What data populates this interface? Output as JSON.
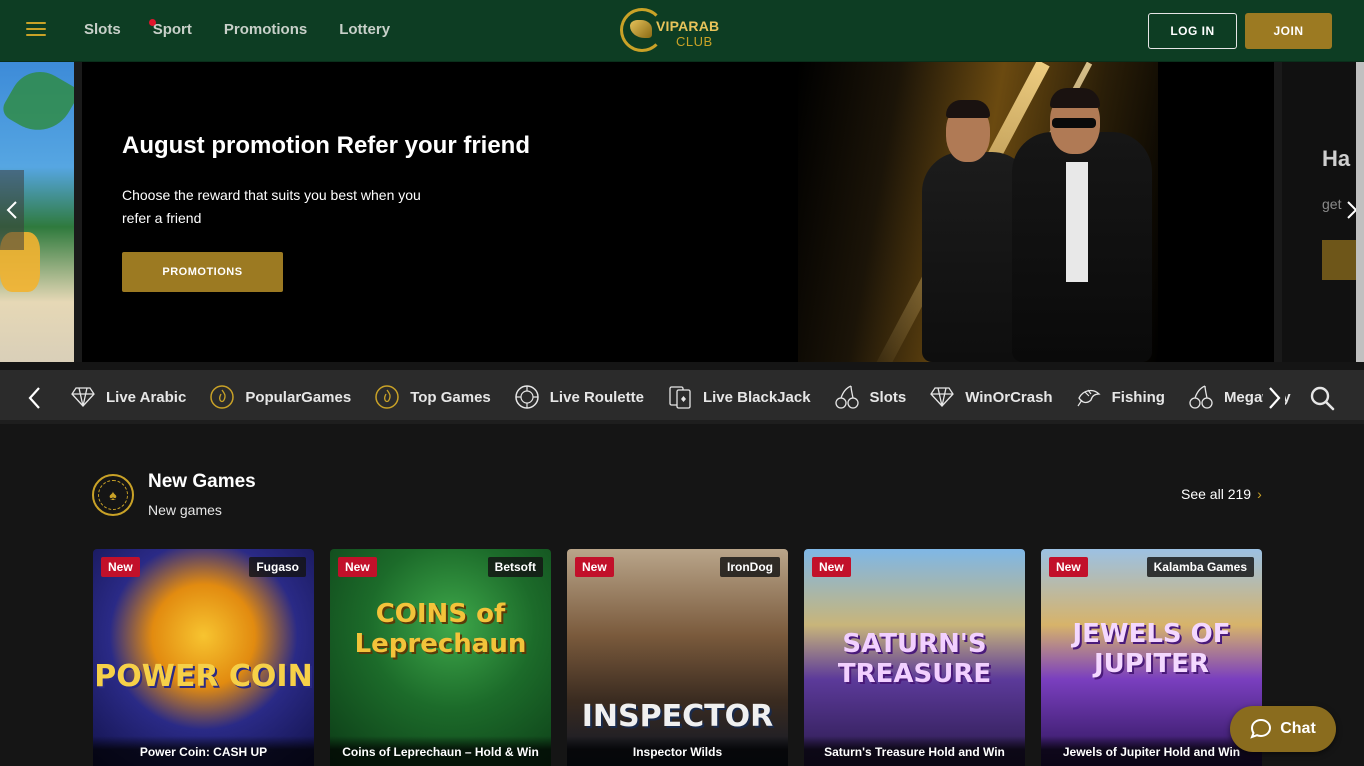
{
  "header": {
    "menu_icon": "hamburger-icon",
    "nav": [
      "Slots",
      "Sport",
      "Promotions",
      "Lottery"
    ],
    "logo_text_1": "VIPARAB",
    "logo_text_2": "CLUB",
    "login_label": "LOG IN",
    "join_label": "JOIN",
    "colors": {
      "header_bg": "#0d3d23",
      "accent": "#9c7a22"
    }
  },
  "banner": {
    "title": "August promotion Refer your friend",
    "text": "Choose the reward that suits you best when you refer a friend",
    "button_label": "PROMOTIONS",
    "next_slide_title": "Ha",
    "next_slide_text": "get"
  },
  "categories": {
    "items": [
      {
        "label": "Live Arabic",
        "icon": "diamond-icon"
      },
      {
        "label": "PopularGames",
        "icon": "flame-coin-icon"
      },
      {
        "label": "Top Games",
        "icon": "flame-coin-icon"
      },
      {
        "label": "Live Roulette",
        "icon": "roulette-icon"
      },
      {
        "label": "Live BlackJack",
        "icon": "cards-icon"
      },
      {
        "label": "Slots",
        "icon": "cherries-icon"
      },
      {
        "label": "WinOrCrash",
        "icon": "diamond-icon"
      },
      {
        "label": "Fishing",
        "icon": "fish-icon"
      },
      {
        "label": "Megaway",
        "icon": "cherries-icon"
      }
    ]
  },
  "section": {
    "title": "New Games",
    "subtitle": "New games",
    "see_all": "See all 219"
  },
  "games": [
    {
      "name": "Power Coin: CASH UP",
      "provider": "Fugaso",
      "badge": "New",
      "logo": "POWER COIN"
    },
    {
      "name": "Coins of Leprechaun – Hold & Win",
      "provider": "Betsoft",
      "badge": "New",
      "logo": "COINS of Leprechaun"
    },
    {
      "name": "Inspector Wilds",
      "provider": "IronDog",
      "badge": "New",
      "logo": "INSPECTOR"
    },
    {
      "name": "Saturn's Treasure Hold and Win",
      "provider": "",
      "badge": "New",
      "logo": "SATURN'S TREASURE"
    },
    {
      "name": "Jewels of Jupiter Hold and Win",
      "provider": "Kalamba Games",
      "badge": "New",
      "logo": "JEWELS OF JUPITER"
    }
  ],
  "chat": {
    "label": "Chat"
  }
}
